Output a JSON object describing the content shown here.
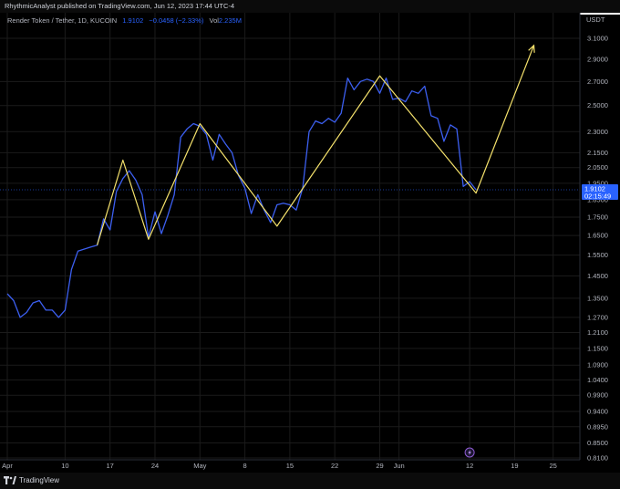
{
  "header": {
    "published": "RhythmicAnalyst published on TradingView.com, Jun 12, 2023 17:44 UTC-4"
  },
  "legend": {
    "symbol": "Render Token / Tether, 1D, KUCOIN",
    "price": "1.9102",
    "change": "−0.0458 (−2.33%)",
    "vol_label": "Vol",
    "vol_value": "2.235M"
  },
  "axis": {
    "unit": "USDT",
    "current_price": "1.9102",
    "countdown": "02:15:49"
  },
  "footer": {
    "brand": "TradingView"
  },
  "colors": {
    "price_line": "#3c5ff0",
    "pattern_line": "#f5e26c",
    "background": "#000000",
    "grid": "#1b1b1b"
  },
  "chart_data": {
    "type": "line",
    "title": "",
    "xlabel": "",
    "ylabel": "",
    "yscale": "log",
    "ylim": [
      0.81,
      3.1
    ],
    "grid": true,
    "y_ticks": [
      "3.1000",
      "2.9000",
      "2.7000",
      "2.5000",
      "2.3000",
      "2.1500",
      "2.0500",
      "1.9500",
      "1.8500",
      "1.7500",
      "1.6500",
      "1.5500",
      "1.4500",
      "1.3500",
      "1.2700",
      "1.2100",
      "1.1500",
      "1.0900",
      "1.0400",
      "0.9900",
      "0.9400",
      "0.8950",
      "0.8500",
      "0.8100"
    ],
    "x_ticks": [
      {
        "label": "Apr",
        "day": 0
      },
      {
        "label": "10",
        "day": 9
      },
      {
        "label": "17",
        "day": 16
      },
      {
        "label": "24",
        "day": 23
      },
      {
        "label": "May",
        "day": 30
      },
      {
        "label": "8",
        "day": 37
      },
      {
        "label": "15",
        "day": 44
      },
      {
        "label": "22",
        "day": 51
      },
      {
        "label": "29",
        "day": 58
      },
      {
        "label": "Jun",
        "day": 61
      },
      {
        "label": "12",
        "day": 72
      },
      {
        "label": "19",
        "day": 79
      },
      {
        "label": "25",
        "day": 85
      }
    ],
    "series": [
      {
        "role": "price",
        "points": [
          [
            0,
            1.37
          ],
          [
            1,
            1.34
          ],
          [
            2,
            1.27
          ],
          [
            3,
            1.29
          ],
          [
            4,
            1.33
          ],
          [
            5,
            1.34
          ],
          [
            6,
            1.3
          ],
          [
            7,
            1.3
          ],
          [
            8,
            1.27
          ],
          [
            9,
            1.3
          ],
          [
            10,
            1.48
          ],
          [
            11,
            1.57
          ],
          [
            12,
            1.58
          ],
          [
            13,
            1.59
          ],
          [
            14,
            1.6
          ],
          [
            15,
            1.74
          ],
          [
            16,
            1.68
          ],
          [
            17,
            1.9
          ],
          [
            18,
            1.98
          ],
          [
            19,
            2.03
          ],
          [
            20,
            1.97
          ],
          [
            21,
            1.88
          ],
          [
            22,
            1.64
          ],
          [
            23,
            1.78
          ],
          [
            24,
            1.66
          ],
          [
            25,
            1.76
          ],
          [
            26,
            1.88
          ],
          [
            27,
            2.26
          ],
          [
            28,
            2.32
          ],
          [
            29,
            2.36
          ],
          [
            30,
            2.34
          ],
          [
            31,
            2.28
          ],
          [
            32,
            2.1
          ],
          [
            33,
            2.28
          ],
          [
            34,
            2.21
          ],
          [
            35,
            2.15
          ],
          [
            36,
            2.0
          ],
          [
            37,
            1.92
          ],
          [
            38,
            1.77
          ],
          [
            39,
            1.88
          ],
          [
            40,
            1.79
          ],
          [
            41,
            1.72
          ],
          [
            42,
            1.82
          ],
          [
            43,
            1.83
          ],
          [
            44,
            1.82
          ],
          [
            45,
            1.79
          ],
          [
            46,
            1.92
          ],
          [
            47,
            2.3
          ],
          [
            48,
            2.38
          ],
          [
            49,
            2.36
          ],
          [
            50,
            2.4
          ],
          [
            51,
            2.37
          ],
          [
            52,
            2.44
          ],
          [
            53,
            2.73
          ],
          [
            54,
            2.63
          ],
          [
            55,
            2.7
          ],
          [
            56,
            2.72
          ],
          [
            57,
            2.7
          ],
          [
            58,
            2.6
          ],
          [
            59,
            2.73
          ],
          [
            60,
            2.55
          ],
          [
            61,
            2.56
          ],
          [
            62,
            2.53
          ],
          [
            63,
            2.62
          ],
          [
            64,
            2.6
          ],
          [
            65,
            2.66
          ],
          [
            66,
            2.42
          ],
          [
            67,
            2.4
          ],
          [
            68,
            2.23
          ],
          [
            69,
            2.35
          ],
          [
            70,
            2.32
          ],
          [
            71,
            1.93
          ],
          [
            72,
            1.96
          ],
          [
            73,
            1.91
          ]
        ]
      },
      {
        "role": "pattern",
        "points": [
          [
            14,
            1.6
          ],
          [
            18,
            2.1
          ],
          [
            22,
            1.63
          ],
          [
            30,
            2.36
          ],
          [
            42,
            1.7
          ],
          [
            58,
            2.75
          ],
          [
            73,
            1.89
          ],
          [
            82,
            3.03
          ]
        ]
      }
    ]
  }
}
